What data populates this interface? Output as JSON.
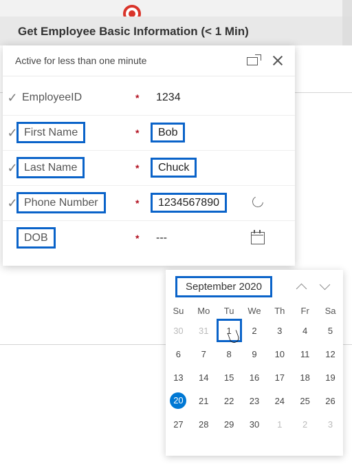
{
  "header": {
    "title": "Get Employee Basic Information  (< 1 Min)"
  },
  "panel": {
    "subtitle": "Active for less than one minute",
    "required": "*",
    "fields": {
      "employee_id": {
        "label": "EmployeeID",
        "value": "1234"
      },
      "first_name": {
        "label": "First Name",
        "value": "Bob"
      },
      "last_name": {
        "label": "Last Name",
        "value": "Chuck"
      },
      "phone": {
        "label": "Phone Number",
        "value": "1234567890"
      },
      "dob": {
        "label": "DOB",
        "value": "---"
      }
    }
  },
  "calendar": {
    "month_label": "September 2020",
    "dow": [
      "Su",
      "Mo",
      "Tu",
      "We",
      "Th",
      "Fr",
      "Sa"
    ],
    "selected_day": 1,
    "today": 20,
    "weeks": [
      [
        {
          "n": 30,
          "dim": true
        },
        {
          "n": 31,
          "dim": true
        },
        {
          "n": 1
        },
        {
          "n": 2
        },
        {
          "n": 3
        },
        {
          "n": 4
        },
        {
          "n": 5
        }
      ],
      [
        {
          "n": 6
        },
        {
          "n": 7
        },
        {
          "n": 8
        },
        {
          "n": 9
        },
        {
          "n": 10
        },
        {
          "n": 11
        },
        {
          "n": 12
        }
      ],
      [
        {
          "n": 13
        },
        {
          "n": 14
        },
        {
          "n": 15
        },
        {
          "n": 16
        },
        {
          "n": 17
        },
        {
          "n": 18
        },
        {
          "n": 19
        }
      ],
      [
        {
          "n": 20
        },
        {
          "n": 21
        },
        {
          "n": 22
        },
        {
          "n": 23
        },
        {
          "n": 24
        },
        {
          "n": 25
        },
        {
          "n": 26
        }
      ],
      [
        {
          "n": 27
        },
        {
          "n": 28
        },
        {
          "n": 29
        },
        {
          "n": 30
        },
        {
          "n": 1,
          "dim": true
        },
        {
          "n": 2,
          "dim": true
        },
        {
          "n": 3,
          "dim": true
        }
      ]
    ]
  }
}
